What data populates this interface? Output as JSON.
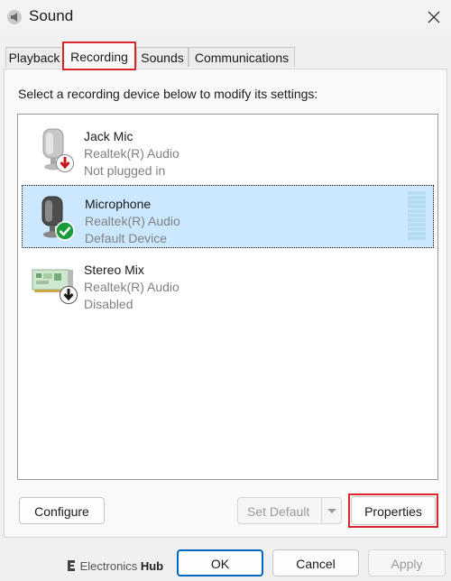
{
  "window": {
    "title": "Sound",
    "icon": "speaker-icon",
    "close_icon": "close-icon"
  },
  "tabs": [
    {
      "label": "Playback",
      "active": false
    },
    {
      "label": "Recording",
      "active": true
    },
    {
      "label": "Sounds",
      "active": false
    },
    {
      "label": "Communications",
      "active": false
    }
  ],
  "recording": {
    "instructions": "Select a recording device below to modify its settings:",
    "devices": [
      {
        "name": "Jack Mic",
        "driver": "Realtek(R) Audio",
        "status": "Not plugged in",
        "icon": "microphone-icon",
        "badge": "red-down-arrow-badge",
        "selected": false
      },
      {
        "name": "Microphone",
        "driver": "Realtek(R) Audio",
        "status": "Default Device",
        "icon": "microphone-icon",
        "badge": "green-check-badge",
        "selected": true
      },
      {
        "name": "Stereo Mix",
        "driver": "Realtek(R) Audio",
        "status": "Disabled",
        "icon": "sound-card-icon",
        "badge": "black-down-arrow-badge",
        "selected": false
      }
    ],
    "buttons": {
      "configure": "Configure",
      "set_default": "Set Default",
      "properties": "Properties"
    }
  },
  "dialog_buttons": {
    "ok": "OK",
    "cancel": "Cancel",
    "apply": "Apply"
  },
  "watermark": {
    "brand_light": "Electronics",
    "brand_bold": "Hub"
  },
  "colors": {
    "selection": "#cce8ff",
    "highlight_box": "#d8262f",
    "focus_border": "#0067c0",
    "badge_red": "#c8171e",
    "badge_green": "#1a9b3a"
  }
}
